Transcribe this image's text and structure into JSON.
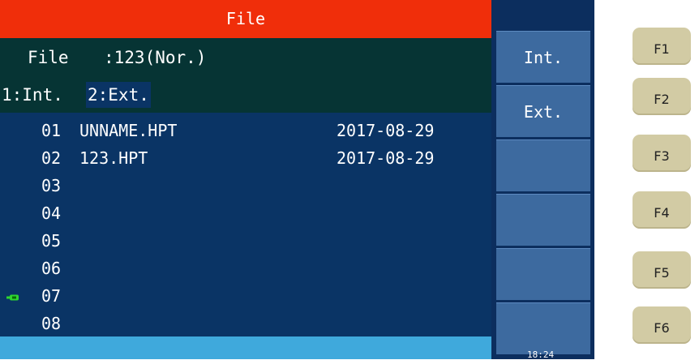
{
  "title": "File",
  "file_info": {
    "label": "File",
    "value": ":123(Nor.)"
  },
  "tabs": [
    {
      "label": "1:Int."
    },
    {
      "label": "2:Ext."
    }
  ],
  "files": [
    {
      "num": "01",
      "name": "UNNAME.HPT",
      "date": "2017-08-29"
    },
    {
      "num": "02",
      "name": "123.HPT",
      "date": "2017-08-29"
    },
    {
      "num": "03",
      "name": "",
      "date": ""
    },
    {
      "num": "04",
      "name": "",
      "date": ""
    },
    {
      "num": "05",
      "name": "",
      "date": ""
    },
    {
      "num": "06",
      "name": "",
      "date": ""
    },
    {
      "num": "07",
      "name": "",
      "date": ""
    },
    {
      "num": "08",
      "name": "",
      "date": ""
    }
  ],
  "softkeys": [
    {
      "label": "Int."
    },
    {
      "label": "Ext."
    },
    {
      "label": ""
    },
    {
      "label": ""
    },
    {
      "label": ""
    },
    {
      "label": ""
    }
  ],
  "time": "18:24",
  "fkeys": [
    {
      "label": "F1"
    },
    {
      "label": "F2"
    },
    {
      "label": "F3"
    },
    {
      "label": "F4"
    },
    {
      "label": "F5"
    },
    {
      "label": "F6"
    }
  ],
  "colors": {
    "title_bg": "#f02e0a",
    "header_bg": "#063434",
    "list_bg": "#0a3465",
    "softkey_bg": "#3d6a9f",
    "bottom_bar": "#3fa9dc",
    "fkey_bg": "#d2cba4",
    "usb_icon": "#2fd62f"
  },
  "icons": {
    "usb": "usb-icon"
  }
}
